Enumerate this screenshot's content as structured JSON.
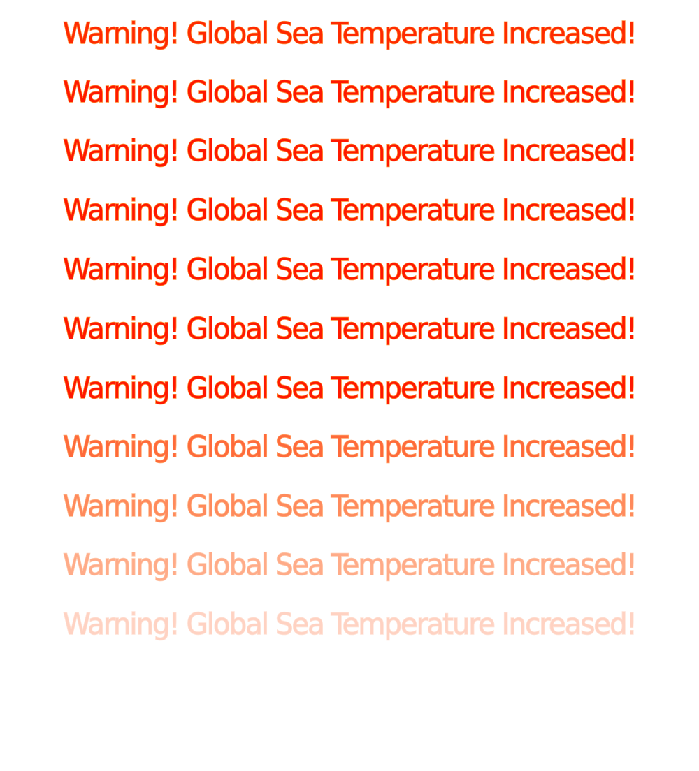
{
  "message": "Warning! Global Sea Temperature Increased!",
  "lines": [
    {
      "text": "Warning! Global Sea Temperature Increased!",
      "fill": "#ff2a00",
      "stroke": "#ff8a3a"
    },
    {
      "text": "Warning! Global Sea Temperature Increased!",
      "fill": "#ff1800",
      "stroke": "#ff8a30"
    },
    {
      "text": "Warning! Global Sea Temperature Increased!",
      "fill": "#ff1800",
      "stroke": "#ff8a30"
    },
    {
      "text": "Warning! Global Sea Temperature Increased!",
      "fill": "#ff1800",
      "stroke": "#ff8a30"
    },
    {
      "text": "Warning! Global Sea Temperature Increased!",
      "fill": "#ff1800",
      "stroke": "#ff8a30"
    },
    {
      "text": "Warning! Global Sea Temperature Increased!",
      "fill": "#ff1800",
      "stroke": "#ff8a30"
    },
    {
      "text": "Warning! Global Sea Temperature Increased!",
      "fill": "#ff1800",
      "stroke": "#ff8a30"
    },
    {
      "text": "Warning! Global Sea Temperature Increased!",
      "fill": "#ff6a3a",
      "stroke": "#ffa266"
    },
    {
      "text": "Warning! Global Sea Temperature Increased!",
      "fill": "#ff8a5c",
      "stroke": "#ffb88a"
    },
    {
      "text": "Warning! Global Sea Temperature Increased!",
      "fill": "#ffab88",
      "stroke": "#ffcaae"
    },
    {
      "text": "Warning! Global Sea Temperature Increased!",
      "fill": "#ffd2c2",
      "stroke": "#ffe2d6"
    }
  ]
}
